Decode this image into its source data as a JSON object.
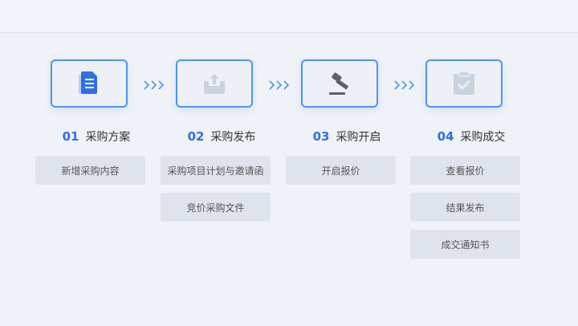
{
  "steps": [
    {
      "num": "01",
      "title": "采购方案",
      "icon": "document-icon",
      "actions": [
        "新增采购内容"
      ]
    },
    {
      "num": "02",
      "title": "采购发布",
      "icon": "upload-tray-icon",
      "actions": [
        "采购项目计划与邀请函",
        "竞价采购文件"
      ]
    },
    {
      "num": "03",
      "title": "采购开启",
      "icon": "gavel-icon",
      "actions": [
        "开启报价"
      ]
    },
    {
      "num": "04",
      "title": "采购成交",
      "icon": "clipboard-check-icon",
      "actions": [
        "查看报价",
        "结果发布",
        "成交通知书"
      ]
    }
  ],
  "colors": {
    "accent": "#2f6fe4",
    "border": "#4d95ec",
    "button_bg": "#dfe4ec",
    "background": "#eff2f7"
  }
}
